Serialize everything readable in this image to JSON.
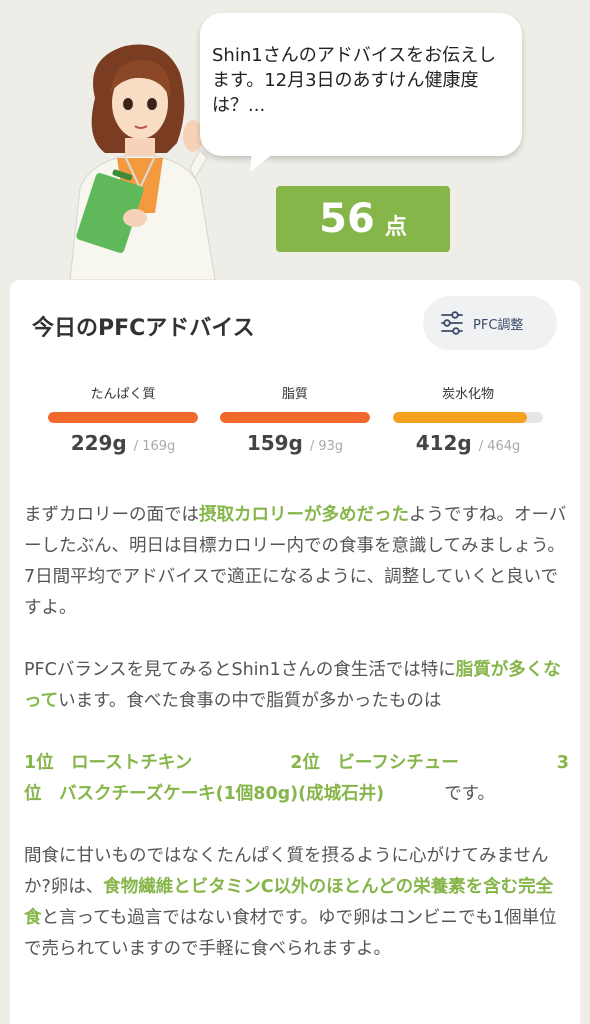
{
  "speech": {
    "text": "Shin1さんのアドバイスをお伝えします。12月3日のあすけん健康度は？..."
  },
  "score": {
    "value": "56",
    "unit": "点"
  },
  "card": {
    "title": "今日のPFCアドバイス",
    "adjust_button": "PFC調整"
  },
  "nutrients": [
    {
      "label": "たんぱく質",
      "value": "229g",
      "target": "/ 169g",
      "fill_ratio": 1.0,
      "color": "#f0682c"
    },
    {
      "label": "脂質",
      "value": "159g",
      "target": "/ 93g",
      "fill_ratio": 1.0,
      "color": "#f0682c"
    },
    {
      "label": "炭水化物",
      "value": "412g",
      "target": "/ 464g",
      "fill_ratio": 0.89,
      "color": "#f4a120"
    }
  ],
  "advice": {
    "p1_a": "まずカロリーの面では",
    "p1_hl": "摂取カロリーが多めだった",
    "p1_b": "ようですね。オーバーしたぶん、明日は目標カロリー内での食事を意識してみましょう。7日間平均でアドバイスで適正になるように、調整していくと良いですよ。",
    "p2_a": "PFCバランスを見てみるとShin1さんの食生活では特に",
    "p2_hl": "脂質が多くなって",
    "p2_b": "います。食べた食事の中で脂質が多かったものは",
    "rank1": "1位　ローストチキン",
    "rank2": "2位　ビーフシチュー",
    "rank3_num": "3",
    "rank3_rest": "位　バスクチーズケーキ(1個80g)(成城石井)",
    "rank_suffix": "です。",
    "p4_a": "間食に甘いものではなくたんぱく質を摂るように心がけてみませんか?卵は、",
    "p4_hl": "食物繊維とビタミンC以外のほとんどの栄養素を含む完全食",
    "p4_b": "と言っても過言ではない食材です。ゆで卵はコンビニでも1個単位で売られていますので手軽に食べられますよ。"
  },
  "colors": {
    "accent_green": "#86b54a",
    "over_orange": "#f0682c",
    "carb_orange": "#f4a120",
    "background": "#eeede7"
  },
  "icons": {
    "adjust": "sliders-icon"
  }
}
